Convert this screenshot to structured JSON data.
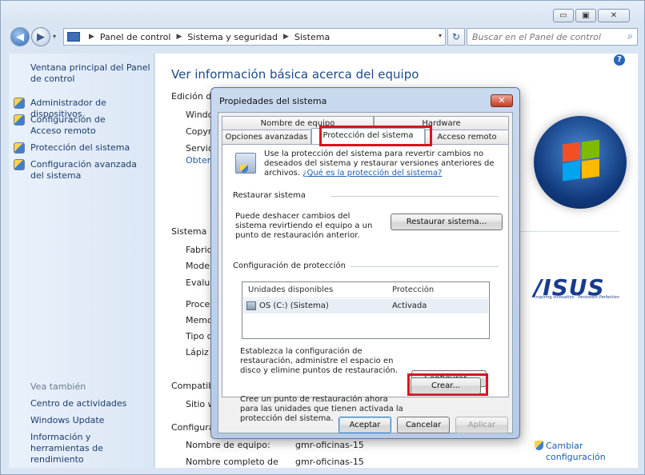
{
  "window": {
    "minimize": "▭",
    "maximize": "▣",
    "close": "✕"
  },
  "addressbar": {
    "back": "◀",
    "forward": "▶",
    "dropdown": "▾",
    "crumbs": [
      "Panel de control",
      "Sistema y seguridad",
      "Sistema"
    ],
    "refresh": "↻",
    "search_placeholder": "Buscar en el Panel de control",
    "search_icon": "⌕"
  },
  "sidebar": {
    "home_link": "Ventana principal del Panel de control",
    "tasks": [
      {
        "label": "Administrador de dispositivos",
        "icon": "shield-icon"
      },
      {
        "label": "Configuración de Acceso remoto",
        "icon": "shield-icon"
      },
      {
        "label": "Protección del sistema",
        "icon": "shield-icon"
      },
      {
        "label": "Configuración avanzada del sistema",
        "icon": "shield-icon"
      }
    ],
    "see_also_title": "Vea también",
    "see_also": [
      "Centro de actividades",
      "Windows Update",
      "Información y herramientas de rendimiento"
    ]
  },
  "main": {
    "help": "?",
    "title": "Ver información básica acerca del equipo",
    "edition_label": "Edición de",
    "edition_rows": [
      "Windo",
      "Copyr",
      "Service"
    ],
    "edition_link": "Obten",
    "system_label": "Sistema",
    "system_rows": [
      "Fabrica",
      "Model",
      "Evalua",
      "Proces",
      "Memo",
      "Tipo d",
      "Lápiz y"
    ],
    "compat_label": "Compatibi",
    "compat_row": "Sitio w",
    "config_label": "Configura",
    "computer_rows": [
      {
        "label": "Nombre de equipo:",
        "value": "gmr-oficinas-15"
      },
      {
        "label": "Nombre completo de",
        "value": "gmr-oficinas-15"
      }
    ],
    "change_config": "Cambiar configuración",
    "brand": "/ISUS",
    "brand_tagline": "Inspiring Innovation · Persistent Perfection"
  },
  "dialog": {
    "title": "Propiedades del sistema",
    "close": "✕",
    "tabs_row1": [
      "Nombre de equipo",
      "Hardware"
    ],
    "tabs_row2": [
      "Opciones avanzadas",
      "Protección del sistema",
      "Acceso remoto"
    ],
    "description": "Use la protección del sistema para revertir cambios no deseados del sistema y restaurar versiones anteriores de archivos.",
    "description_link": "¿Qué es la protección del sistema?",
    "restore_group": "Restaurar sistema",
    "restore_desc": "Puede deshacer cambios del sistema revirtiendo el equipo a un punto de restauración anterior.",
    "restore_button": "Restaurar sistema...",
    "protection_group": "Configuración de protección",
    "list_headers": [
      "Unidades disponibles",
      "Protección"
    ],
    "list_rows": [
      {
        "drive": "OS (C:) (Sistema)",
        "protection": "Activada"
      }
    ],
    "configure_desc": "Establezca la configuración de restauración, administre el espacio en disco y elimine puntos de restauración.",
    "configure_button": "Configurar...",
    "create_desc": "Cree un punto de restauración ahora para las unidades que tienen activada la protección del sistema.",
    "create_button": "Crear...",
    "ok_button": "Aceptar",
    "cancel_button": "Cancelar",
    "apply_button": "Aplicar"
  },
  "colors": {
    "highlight": "#d9141e",
    "link": "#1e5fb0",
    "title": "#1e4a8c"
  }
}
